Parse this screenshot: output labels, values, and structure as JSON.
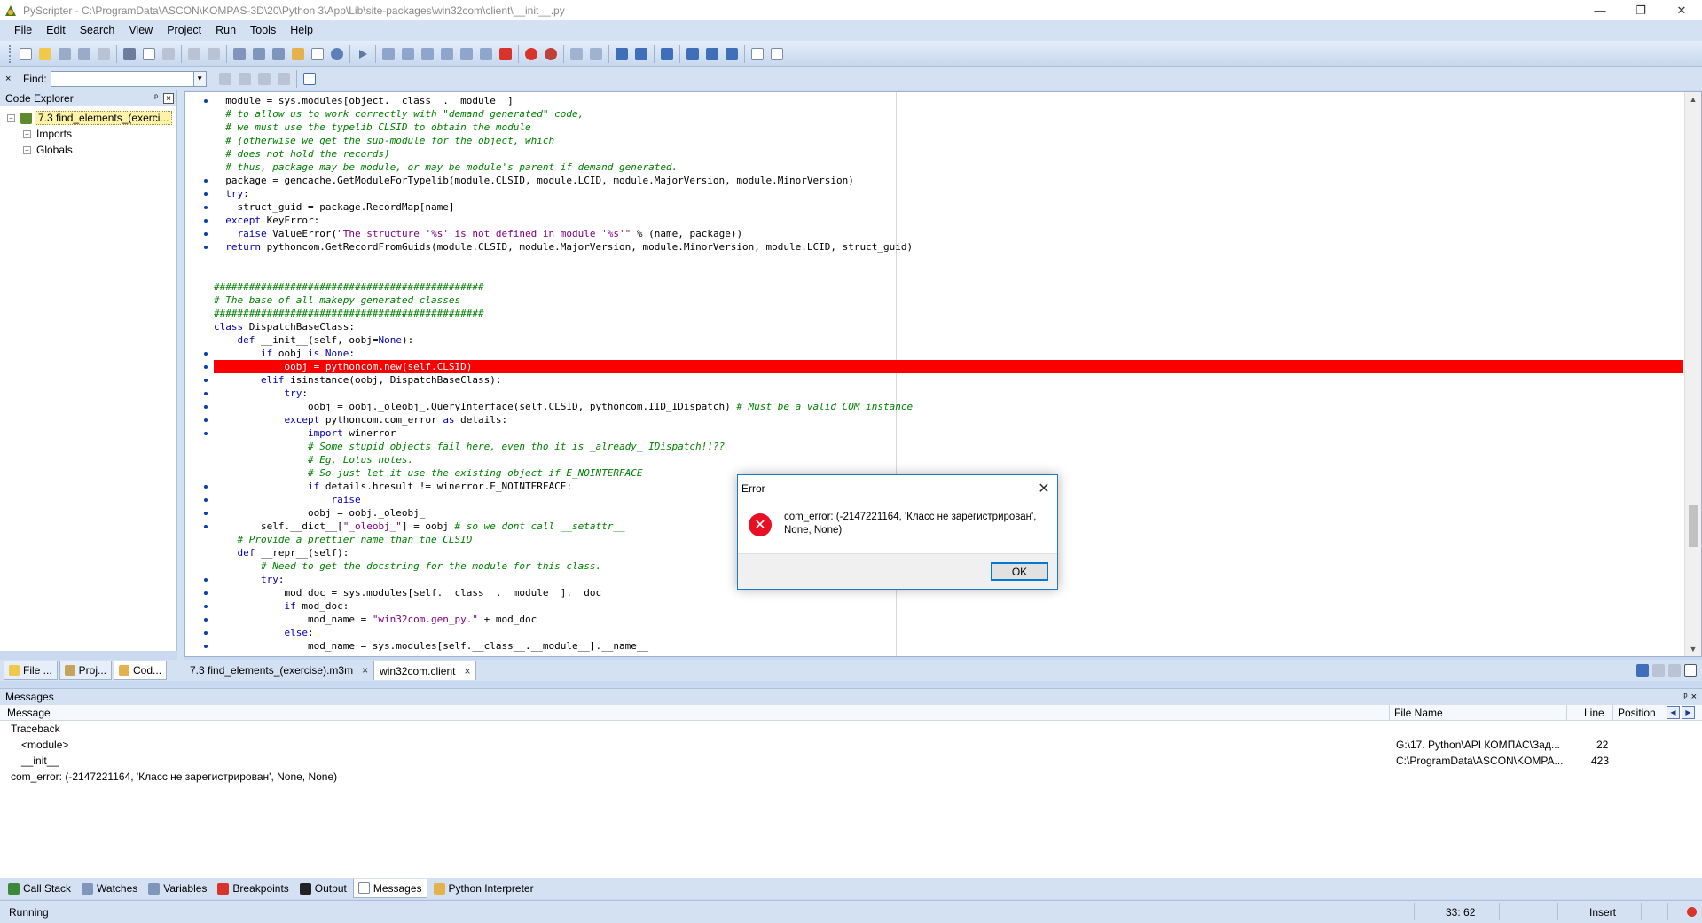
{
  "window": {
    "title": "PyScripter - C:\\ProgramData\\ASCON\\KOMPAS-3D\\20\\Python 3\\App\\Lib\\site-packages\\win32com\\client\\__init__.py",
    "minimize": "—",
    "maximize": "❐",
    "close": "✕"
  },
  "menu": [
    "File",
    "Edit",
    "Search",
    "View",
    "Project",
    "Run",
    "Tools",
    "Help"
  ],
  "findbar": {
    "close": "×",
    "label": "Find:",
    "value": ""
  },
  "code_explorer": {
    "title": "Code Explorer",
    "pin": "ᵖ",
    "close": "×",
    "tree": [
      {
        "label": "7.3 find_elements_(exerci...",
        "expand": "−",
        "selected": true
      },
      {
        "label": "Imports",
        "expand": "+",
        "selected": false
      },
      {
        "label": "Globals",
        "expand": "+",
        "selected": false
      }
    ]
  },
  "left_tabs": [
    "File ...",
    "Proj...",
    "Cod..."
  ],
  "editor_tabs": [
    {
      "label": "7.3 find_elements_(exercise).m3m",
      "close": "×",
      "active": false
    },
    {
      "label": "win32com.client",
      "close": "×",
      "active": true
    }
  ],
  "code_lines": [
    [
      {
        "t": "  module = sys.modules[object.",
        "c": ""
      },
      {
        "t": "__class__",
        "c": ""
      },
      {
        "t": ".",
        "c": ""
      },
      {
        "t": "__module__",
        "c": ""
      },
      {
        "t": "]",
        "c": ""
      }
    ],
    [
      {
        "t": "  # to allow us to work correctly with \"demand generated\" code,",
        "c": "cm"
      }
    ],
    [
      {
        "t": "  # we must use the typelib CLSID to obtain the module",
        "c": "cm"
      }
    ],
    [
      {
        "t": "  # (otherwise we get the sub-module for the object, which",
        "c": "cm"
      }
    ],
    [
      {
        "t": "  # does not hold the records)",
        "c": "cm"
      }
    ],
    [
      {
        "t": "  # thus, package may be module, or may be module's parent if demand generated.",
        "c": "cm"
      }
    ],
    [
      {
        "t": "  package = gencache.GetModuleForTypelib(module.CLSID, module.LCID, module.MajorVersion, module.MinorVersion)",
        "c": ""
      }
    ],
    [
      {
        "t": "  ",
        "c": ""
      },
      {
        "t": "try",
        "c": "kw"
      },
      {
        "t": ":",
        "c": ""
      }
    ],
    [
      {
        "t": "    struct_guid = package.RecordMap[name]",
        "c": ""
      }
    ],
    [
      {
        "t": "  ",
        "c": ""
      },
      {
        "t": "except",
        "c": "kw"
      },
      {
        "t": " KeyError:",
        "c": ""
      }
    ],
    [
      {
        "t": "    ",
        "c": ""
      },
      {
        "t": "raise",
        "c": "kw"
      },
      {
        "t": " ValueError(",
        "c": ""
      },
      {
        "t": "\"The structure '%s' is not defined in module '%s'\"",
        "c": "st"
      },
      {
        "t": " % (name, package))",
        "c": ""
      }
    ],
    [
      {
        "t": "  ",
        "c": ""
      },
      {
        "t": "return",
        "c": "kw"
      },
      {
        "t": " pythoncom.GetRecordFromGuids(module.CLSID, module.MajorVersion, module.MinorVersion, module.LCID, struct_guid)",
        "c": ""
      }
    ],
    [],
    [],
    [
      {
        "t": "##############################################",
        "c": "cm"
      }
    ],
    [
      {
        "t": "# The base of all makepy generated classes",
        "c": "cm"
      }
    ],
    [
      {
        "t": "##############################################",
        "c": "cm"
      }
    ],
    [
      {
        "t": "class",
        "c": "kw"
      },
      {
        "t": " DispatchBaseClass:",
        "c": ""
      }
    ],
    [
      {
        "t": "    ",
        "c": ""
      },
      {
        "t": "def",
        "c": "kw"
      },
      {
        "t": " __init__(self, oobj=",
        "c": ""
      },
      {
        "t": "None",
        "c": "kw"
      },
      {
        "t": "):",
        "c": ""
      }
    ],
    [
      {
        "t": "        ",
        "c": ""
      },
      {
        "t": "if",
        "c": "kw"
      },
      {
        "t": " oobj ",
        "c": ""
      },
      {
        "t": "is",
        "c": "kw"
      },
      {
        "t": " ",
        "c": ""
      },
      {
        "t": "None",
        "c": "kw"
      },
      {
        "t": ":",
        "c": ""
      }
    ],
    [
      {
        "t": "            oobj = pythoncom.new(self.CLSID)",
        "c": ""
      }
    ],
    [
      {
        "t": "        ",
        "c": ""
      },
      {
        "t": "elif",
        "c": "kw"
      },
      {
        "t": " isinstance(oobj, DispatchBaseClass):",
        "c": ""
      }
    ],
    [
      {
        "t": "            ",
        "c": ""
      },
      {
        "t": "try",
        "c": "kw"
      },
      {
        "t": ":",
        "c": ""
      }
    ],
    [
      {
        "t": "                oobj = oobj._oleobj_.QueryInterface(self.CLSID, pythoncom.IID_IDispatch) ",
        "c": ""
      },
      {
        "t": "# Must be a valid COM instance",
        "c": "cm"
      }
    ],
    [
      {
        "t": "            ",
        "c": ""
      },
      {
        "t": "except",
        "c": "kw"
      },
      {
        "t": " pythoncom.com_error ",
        "c": ""
      },
      {
        "t": "as",
        "c": "kw"
      },
      {
        "t": " details:",
        "c": ""
      }
    ],
    [
      {
        "t": "                ",
        "c": ""
      },
      {
        "t": "import",
        "c": "kw"
      },
      {
        "t": " winerror",
        "c": ""
      }
    ],
    [
      {
        "t": "                # Some stupid objects fail here, even tho it is _already_ IDispatch!!??",
        "c": "cm"
      }
    ],
    [
      {
        "t": "                # Eg, Lotus notes.",
        "c": "cm"
      }
    ],
    [
      {
        "t": "                # So just let it use the existing object if E_NOINTERFACE",
        "c": "cm"
      }
    ],
    [
      {
        "t": "                ",
        "c": ""
      },
      {
        "t": "if",
        "c": "kw"
      },
      {
        "t": " details.hresult != winerror.E_NOINTERFACE:",
        "c": ""
      }
    ],
    [
      {
        "t": "                    ",
        "c": ""
      },
      {
        "t": "raise",
        "c": "kw"
      }
    ],
    [
      {
        "t": "                oobj = oobj._oleobj_",
        "c": ""
      }
    ],
    [
      {
        "t": "        self.",
        "c": ""
      },
      {
        "t": "__dict__",
        "c": ""
      },
      {
        "t": "[",
        "c": ""
      },
      {
        "t": "\"_oleobj_\"",
        "c": "st"
      },
      {
        "t": "] = oobj ",
        "c": ""
      },
      {
        "t": "# so we dont call __setattr__",
        "c": "cm"
      }
    ],
    [
      {
        "t": "    # Provide a prettier name than the CLSID",
        "c": "cm"
      }
    ],
    [
      {
        "t": "    ",
        "c": ""
      },
      {
        "t": "def",
        "c": "kw"
      },
      {
        "t": " __repr__(self):",
        "c": ""
      }
    ],
    [
      {
        "t": "        # Need to get the docstring for the module for this class.",
        "c": "cm"
      }
    ],
    [
      {
        "t": "        ",
        "c": ""
      },
      {
        "t": "try",
        "c": "kw"
      },
      {
        "t": ":",
        "c": ""
      }
    ],
    [
      {
        "t": "            mod_doc = sys.modules[self.__class__.__module__].__doc__",
        "c": ""
      }
    ],
    [
      {
        "t": "            ",
        "c": ""
      },
      {
        "t": "if",
        "c": "kw"
      },
      {
        "t": " mod_doc:",
        "c": ""
      }
    ],
    [
      {
        "t": "                mod_name = ",
        "c": ""
      },
      {
        "t": "\"win32com.gen_py.\"",
        "c": "st"
      },
      {
        "t": " + mod_doc",
        "c": ""
      }
    ],
    [
      {
        "t": "            ",
        "c": ""
      },
      {
        "t": "else",
        "c": "kw"
      },
      {
        "t": ":",
        "c": ""
      }
    ],
    [
      {
        "t": "                mod_name = sys.modules[self.__class__.__module__].__name__",
        "c": ""
      }
    ]
  ],
  "highlight_line": 20,
  "gutter_dot_lines": [
    0,
    6,
    7,
    8,
    9,
    10,
    11,
    19,
    20,
    21,
    22,
    23,
    24,
    25,
    29,
    30,
    31,
    32,
    36,
    37,
    38,
    39,
    40,
    41
  ],
  "messages": {
    "title": "Messages",
    "pin": "ᵖ",
    "close": "×",
    "columns": {
      "message": "Message",
      "file": "File Name",
      "line": "Line",
      "position": "Position"
    },
    "nav_left": "◀",
    "nav_right": "▶",
    "rows": [
      {
        "message": "Traceback",
        "file": "",
        "line": "",
        "indent": 0
      },
      {
        "message": "<module>",
        "file": "G:\\17. Python\\API КОМПАС\\Зад...",
        "line": "22",
        "indent": 1
      },
      {
        "message": "__init__",
        "file": "C:\\ProgramData\\ASCON\\KOMPA...",
        "line": "423",
        "indent": 1
      },
      {
        "message": "com_error: (-2147221164, 'Класс не зарегистрирован', None, None)",
        "file": "",
        "line": "",
        "indent": 0
      }
    ]
  },
  "bottom_tabs": [
    "Call Stack",
    "Watches",
    "Variables",
    "Breakpoints",
    "Output",
    "Messages",
    "Python Interpreter"
  ],
  "bottom_active": "Messages",
  "status": {
    "state": "Running",
    "position": "33: 62",
    "mode": "Insert"
  },
  "dialog": {
    "title": "Error",
    "close": "✕",
    "icon": "✕",
    "message": "com_error: (-2147221164, 'Класс не зарегистрирован', None, None)",
    "ok": "OK"
  },
  "colors": {
    "highlight": "#fb0000",
    "chrome": "#d4e1f3",
    "keyword": "#0000b0",
    "comment": "#008000",
    "string": "#800080"
  }
}
